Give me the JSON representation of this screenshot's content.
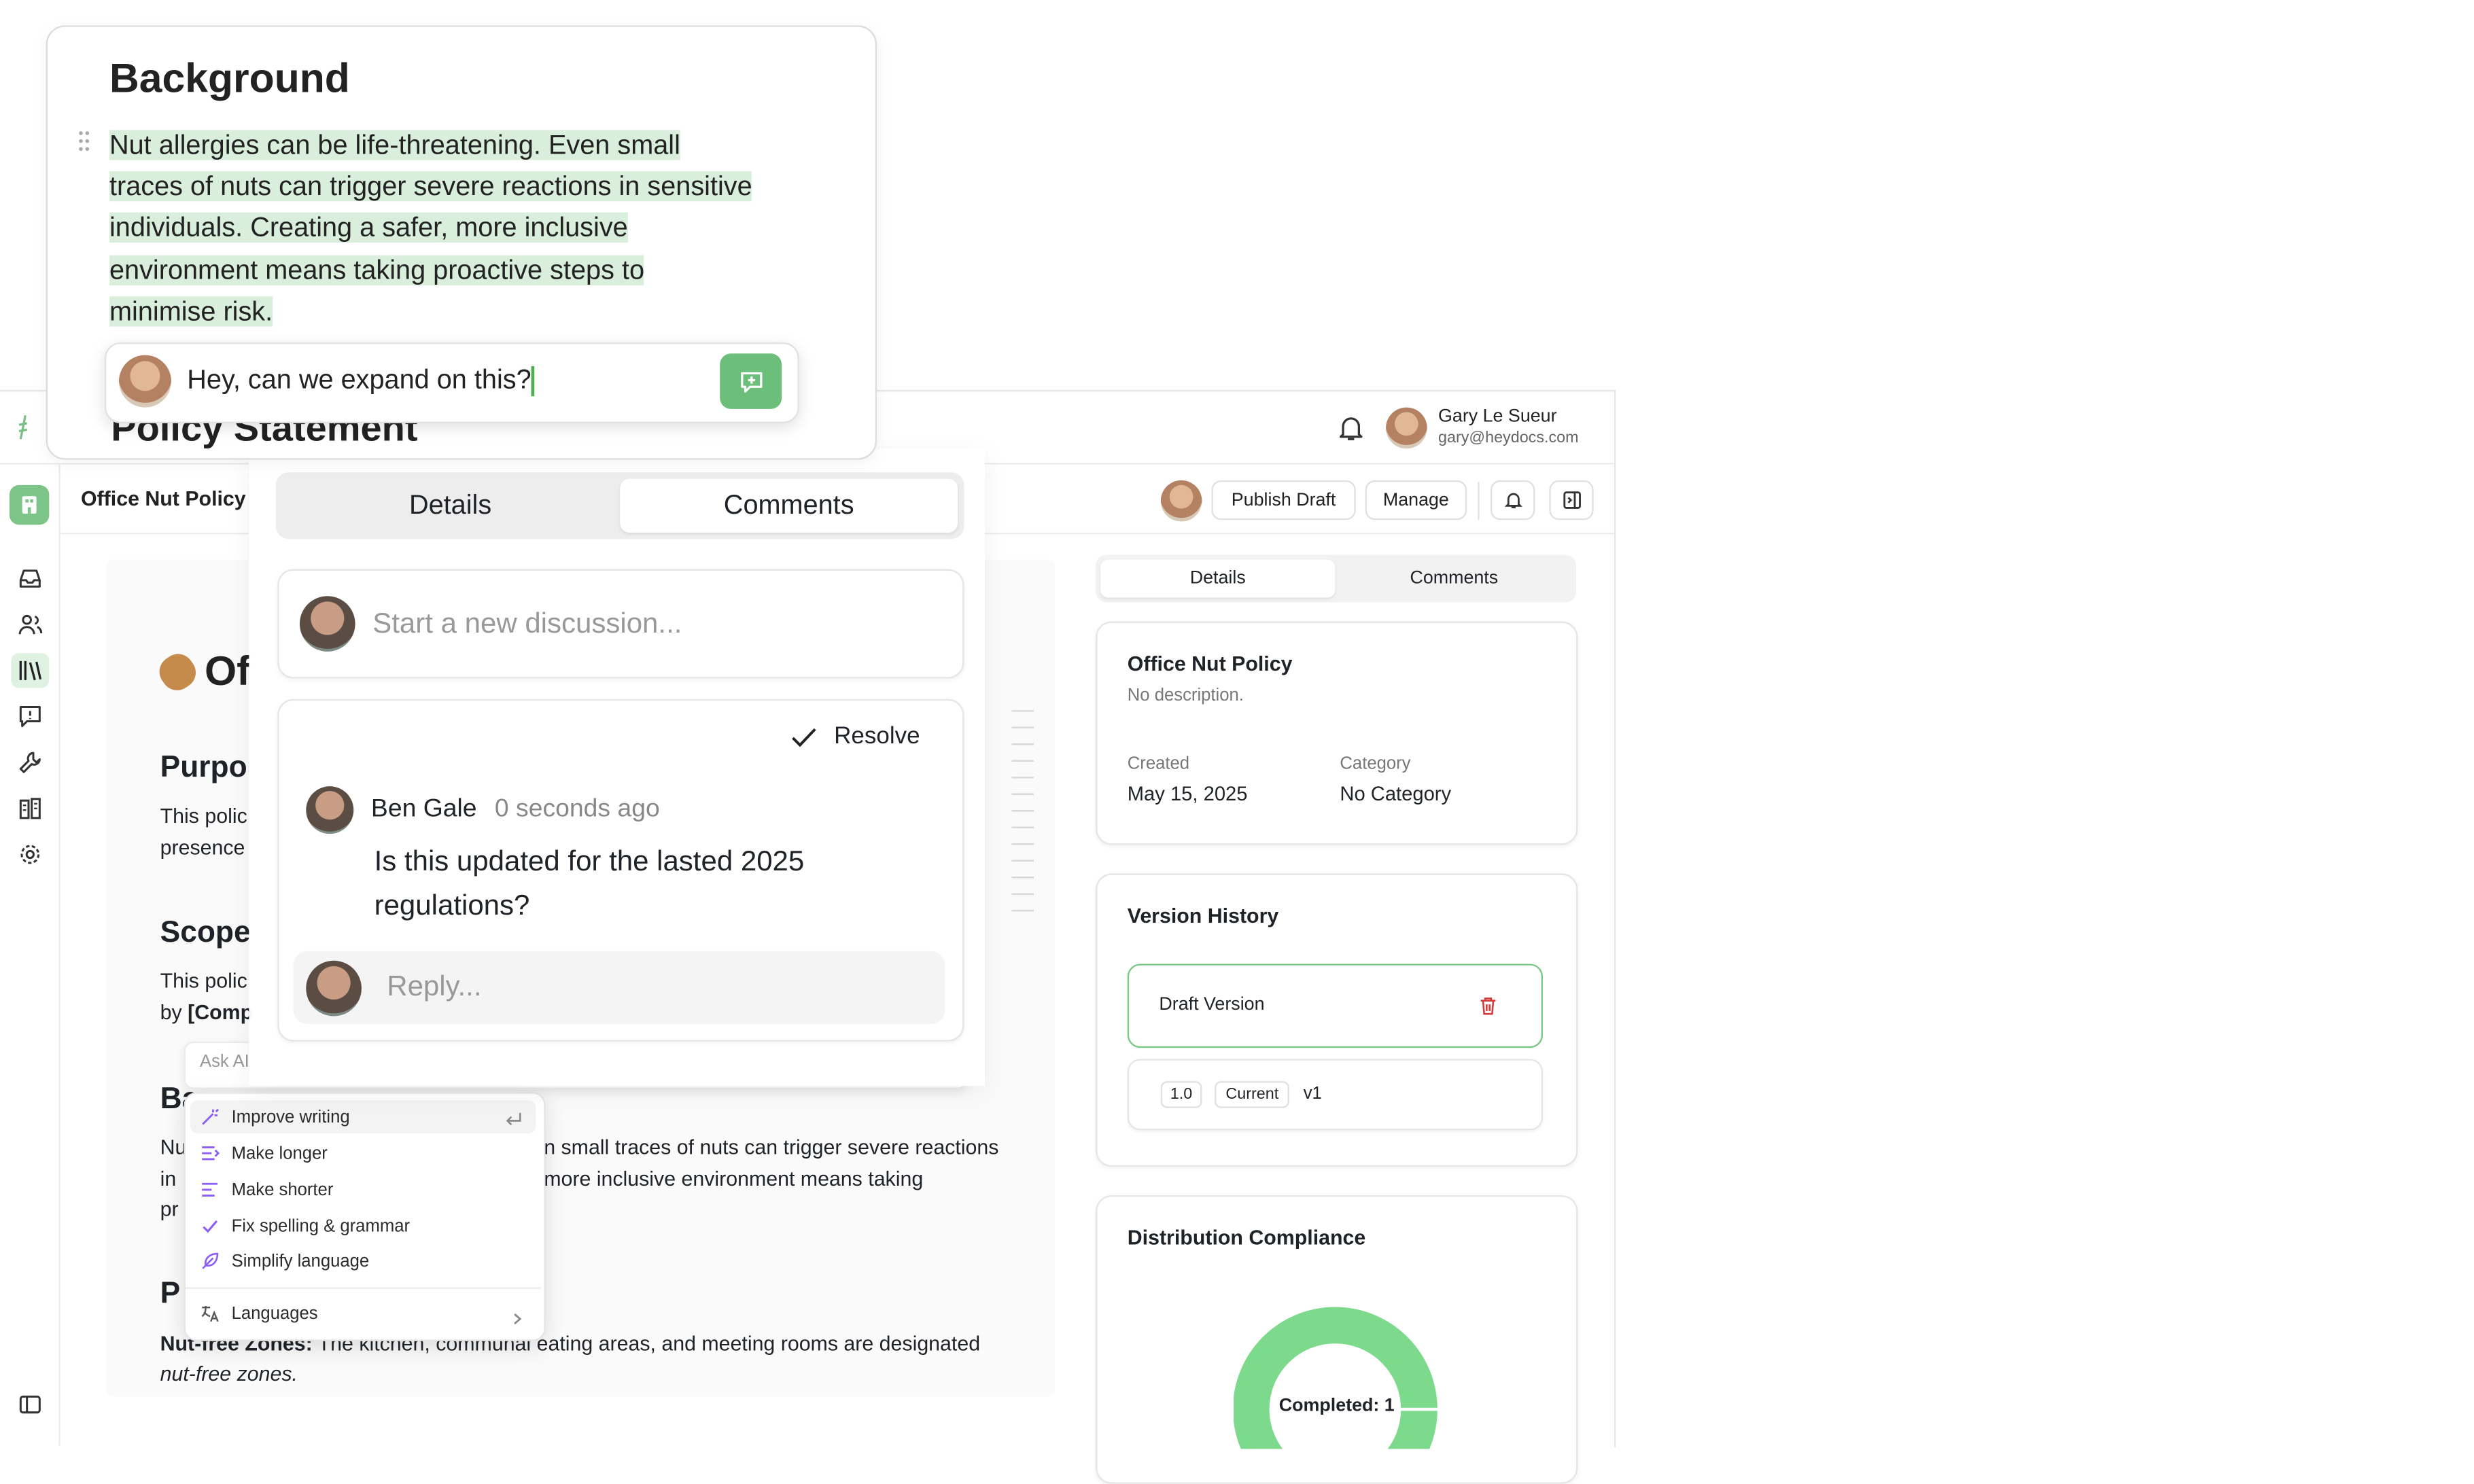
{
  "app": {
    "user": {
      "name": "Gary Le Sueur",
      "email": "gary@heydocs.com"
    },
    "doc_title": "Office Nut Policy",
    "publish_label": "Publish Draft",
    "manage_label": "Manage"
  },
  "document": {
    "heading_partial": "Of",
    "purpose_partial": "Purpo",
    "purpose_line1": "This polic",
    "purpose_line2": "presence",
    "scope_partial": "Scope",
    "scope_line1": "This polic",
    "scope_line2_a": "by ",
    "scope_line2_b": "[Comp",
    "background_partial": "Ba",
    "bg_line1_a": "Nu",
    "bg_line1_b": "n small traces of nuts can trigger severe reactions",
    "bg_line2_a": "in",
    "bg_line2_b": "more inclusive environment means taking",
    "bg_line3_a": "pr",
    "policy_partial": "P",
    "nutfree_label": "Nut-free Zones:",
    "nutfree_text": " The kitchen, communal eating areas, and meeting rooms are designated",
    "nutfree_line2": "nut-free zones."
  },
  "ai_menu": {
    "input_placeholder": "Ask AI",
    "items": [
      "Improve writing",
      "Make longer",
      "Make shorter",
      "Fix spelling & grammar",
      "Simplify language"
    ],
    "languages": "Languages"
  },
  "zoom_background": {
    "heading": "Background",
    "lines": [
      "Nut allergies can be life-threatening. Even small",
      "traces of nuts can trigger severe reactions in sensitive",
      "individuals. Creating a safer, more inclusive",
      "environment means taking proactive steps to",
      "minimise risk."
    ],
    "comment_input": "Hey, can we expand on this?",
    "below_heading": "Policy Statement"
  },
  "zoom_comments": {
    "tabs": [
      "Details",
      "Comments"
    ],
    "new_discussion_placeholder": "Start a new discussion...",
    "resolve_label": "Resolve",
    "author": "Ben Gale",
    "time": "0 seconds ago",
    "message_line1": "Is this updated for the lasted 2025",
    "message_line2": "regulations?",
    "reply_placeholder": "Reply..."
  },
  "panel": {
    "tabs": [
      "Details",
      "Comments"
    ],
    "info": {
      "title": "Office Nut Policy",
      "description": "No description.",
      "created_label": "Created",
      "created_value": "May 15, 2025",
      "category_label": "Category",
      "category_value": "No Category"
    },
    "version_history": {
      "title": "Version History",
      "draft_label": "Draft Version",
      "version_number": "1.0",
      "current_badge": "Current",
      "version_name": "v1"
    },
    "distribution": {
      "title": "Distribution Compliance",
      "completed_label": "Completed: 1",
      "completed_fraction": 1.0,
      "ring_color": "#7dd98c"
    }
  }
}
